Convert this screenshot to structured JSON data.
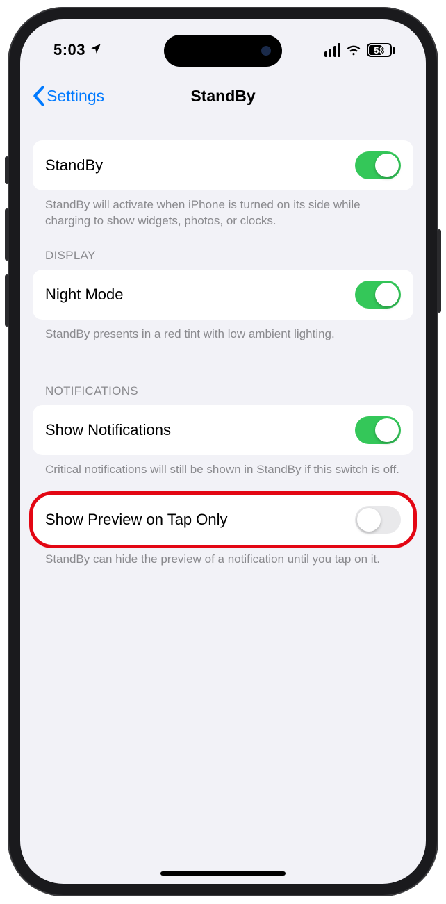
{
  "status": {
    "time": "5:03",
    "battery": "58"
  },
  "nav": {
    "back": "Settings",
    "title": "StandBy"
  },
  "groups": {
    "main": {
      "standby": {
        "label": "StandBy",
        "on": true
      },
      "footer": "StandBy will activate when iPhone is turned on its side while charging to show widgets, photos, or clocks."
    },
    "display": {
      "header": "DISPLAY",
      "nightmode": {
        "label": "Night Mode",
        "on": true
      },
      "footer": "StandBy presents in a red tint with low ambient lighting."
    },
    "notifications": {
      "header": "NOTIFICATIONS",
      "show": {
        "label": "Show Notifications",
        "on": true
      },
      "show_footer": "Critical notifications will still be shown in StandBy if this switch is off.",
      "preview": {
        "label": "Show Preview on Tap Only",
        "on": false
      },
      "preview_footer": "StandBy can hide the preview of a notification until you tap on it."
    }
  }
}
